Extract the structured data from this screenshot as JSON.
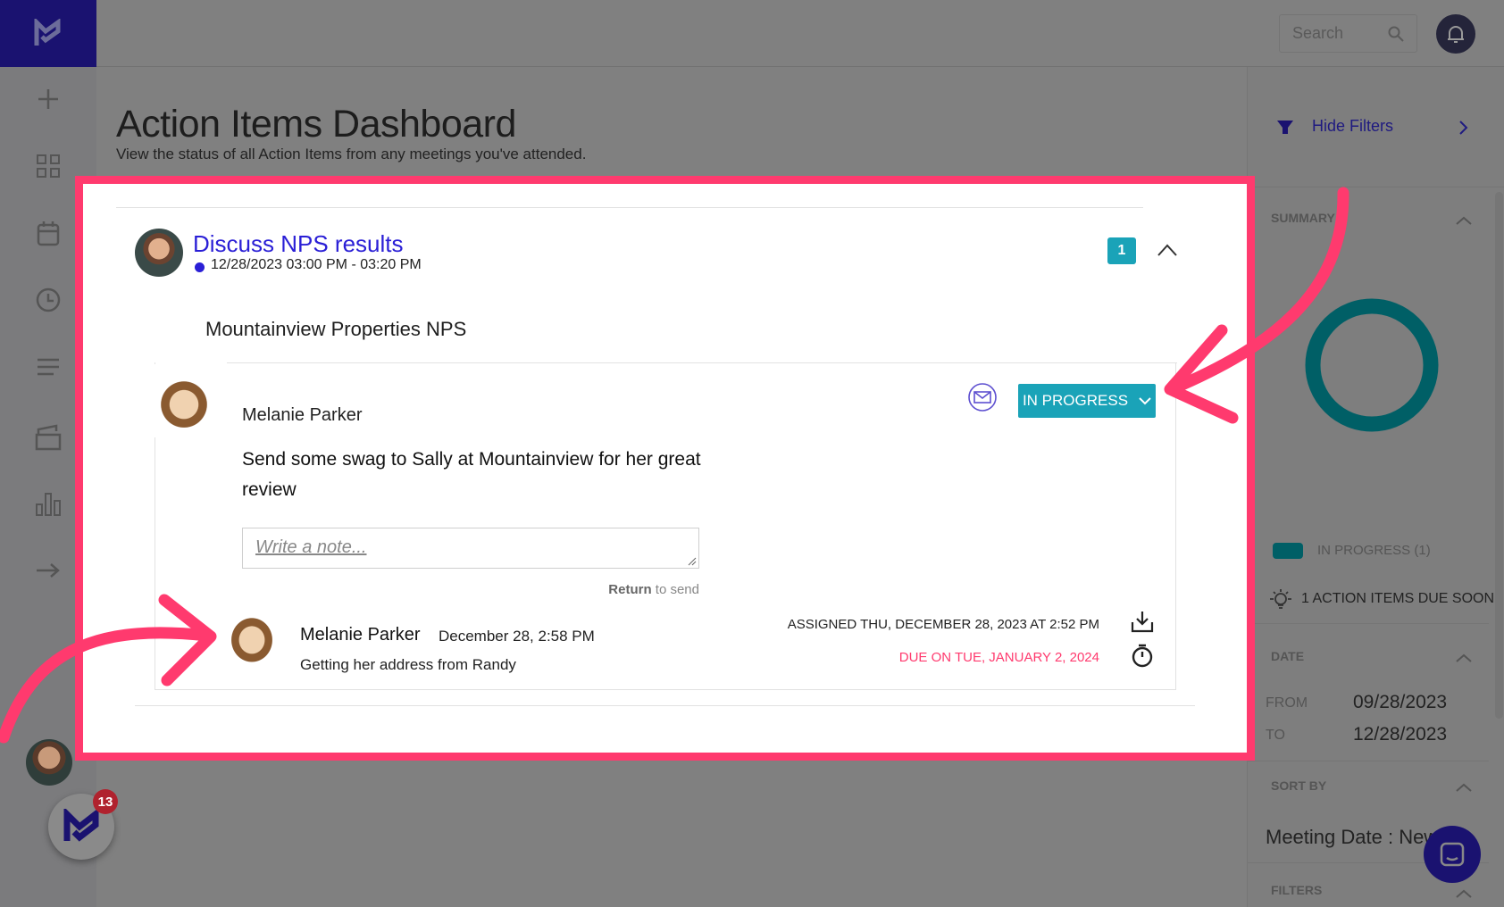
{
  "header": {
    "title": "Action Items Dashboard",
    "subtitle": "View the status of all Action Items from any meetings you've attended.",
    "search_placeholder": "Search"
  },
  "sidebar": {
    "items": [
      "add-icon",
      "dashboard-icon",
      "calendar-icon",
      "clock-icon",
      "list-icon",
      "folder-icon",
      "chart-icon",
      "arrow-right-icon"
    ],
    "notification_count": "13"
  },
  "meeting": {
    "title": "Discuss NPS results",
    "datetime": "12/28/2023 03:00 PM - 03:20 PM",
    "count": "1",
    "topic": "Mountainview Properties NPS"
  },
  "action_item": {
    "owner": "Melanie Parker",
    "text": "Send some swag to Sally at Mountainview for her great review",
    "status": "IN PROGRESS",
    "note_placeholder": "Write a note...",
    "hint_bold": "Return",
    "hint_rest": " to send",
    "comment": {
      "author": "Melanie Parker",
      "date": "December 28, 2:58 PM",
      "text": "Getting her address from Randy"
    },
    "assigned": "ASSIGNED THU, DECEMBER 28, 2023 AT 2:52 PM",
    "due": "DUE ON TUE, JANUARY 2, 2024"
  },
  "filters": {
    "hide_label": "Hide Filters",
    "summary_label": "SUMMARY",
    "legend": "IN PROGRESS (1)",
    "due_soon": "1 ACTION ITEMS DUE SOON",
    "date_label": "DATE",
    "from_label": "FROM",
    "from": "09/28/2023",
    "to_label": "TO",
    "to": "12/28/2023",
    "sort_label": "SORT BY",
    "sort_value": "Meeting Date : Newest",
    "filters_label": "FILTERS"
  },
  "colors": {
    "brand": "#1a1270",
    "accent": "#1aa3b8",
    "due": "#ff3a6e",
    "highlight": "#ff3a6e",
    "in_progress": "#005f66"
  }
}
